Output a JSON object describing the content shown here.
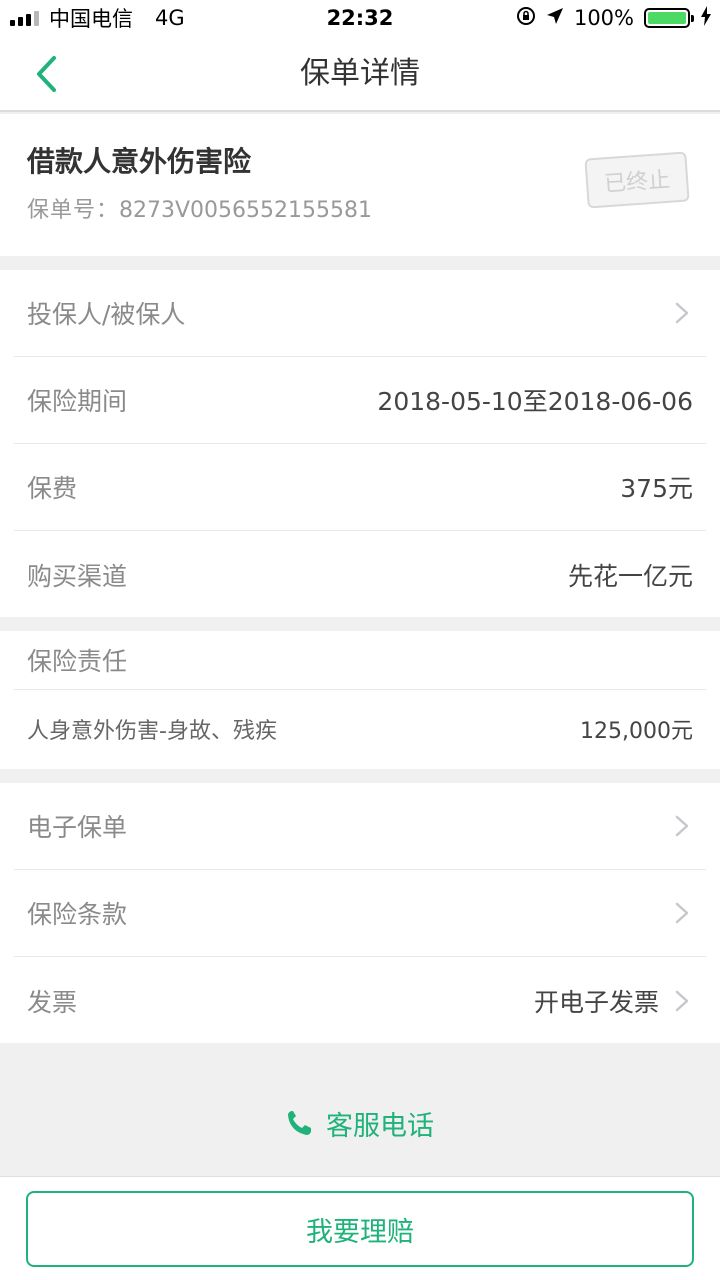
{
  "status_bar": {
    "carrier": "中国电信",
    "network": "4G",
    "time": "22:32",
    "battery": "100%",
    "battery_level": 1.0
  },
  "nav": {
    "title": "保单详情"
  },
  "policy": {
    "name": "借款人意外伤害险",
    "number_label": "保单号：",
    "number": "8273V0056552155581",
    "status": "已终止"
  },
  "info": {
    "applicant_label": "投保人/被保人",
    "period_label": "保险期间",
    "period_value": "2018-05-10至2018-06-06",
    "premium_label": "保费",
    "premium_value": "375元",
    "channel_label": "购买渠道",
    "channel_value": "先花一亿元"
  },
  "liability": {
    "title": "保险责任",
    "item_label": "人身意外伤害-身故、残疾",
    "item_value": "125,000元"
  },
  "documents": {
    "e_policy_label": "电子保单",
    "terms_label": "保险条款",
    "invoice_label": "发票",
    "invoice_value": "开电子发票"
  },
  "service": {
    "label": "客服电话"
  },
  "actions": {
    "claim_label": "我要理赔"
  },
  "colors": {
    "accent": "#1fb27a",
    "battery": "#4cd964"
  }
}
